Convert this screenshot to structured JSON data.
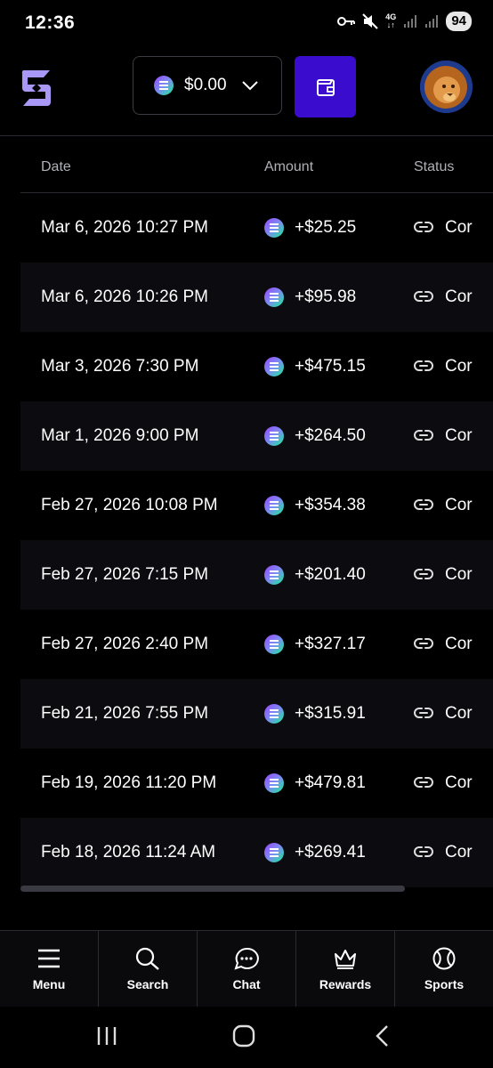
{
  "status_bar": {
    "time": "12:36",
    "network": [
      "4G",
      "↓↑"
    ],
    "battery": "94",
    "icons": [
      "vpn-key-icon",
      "mute-icon",
      "signal-icon",
      "signal-icon"
    ]
  },
  "header": {
    "logo": "app-logo-icon",
    "balance": "$0.00",
    "wallet_icon": "wallet-icon",
    "avatar": "lion-avatar",
    "accent_color": "#3a0ccd"
  },
  "table": {
    "columns": [
      "Date",
      "Amount",
      "Status"
    ],
    "rows": [
      {
        "date": "Mar 6, 2026 10:27 PM",
        "amount": "+$25.25",
        "status": "Cor"
      },
      {
        "date": "Mar 6, 2026 10:26 PM",
        "amount": "+$95.98",
        "status": "Cor"
      },
      {
        "date": "Mar 3, 2026 7:30 PM",
        "amount": "+$475.15",
        "status": "Cor"
      },
      {
        "date": "Mar 1, 2026 9:00 PM",
        "amount": "+$264.50",
        "status": "Cor"
      },
      {
        "date": "Feb 27, 2026 10:08 PM",
        "amount": "+$354.38",
        "status": "Cor"
      },
      {
        "date": "Feb 27, 2026 7:15 PM",
        "amount": "+$201.40",
        "status": "Cor"
      },
      {
        "date": "Feb 27, 2026 2:40 PM",
        "amount": "+$327.17",
        "status": "Cor"
      },
      {
        "date": "Feb 21, 2026 7:55 PM",
        "amount": "+$315.91",
        "status": "Cor"
      },
      {
        "date": "Feb 19, 2026 11:20 PM",
        "amount": "+$479.81",
        "status": "Cor"
      },
      {
        "date": "Feb 18, 2026 11:24 AM",
        "amount": "+$269.41",
        "status": "Cor"
      }
    ]
  },
  "bottom_nav": [
    {
      "label": "Menu",
      "icon": "menu-icon"
    },
    {
      "label": "Search",
      "icon": "search-icon"
    },
    {
      "label": "Chat",
      "icon": "chat-icon"
    },
    {
      "label": "Rewards",
      "icon": "crown-icon"
    },
    {
      "label": "Sports",
      "icon": "ball-icon"
    }
  ],
  "system_nav": [
    "recents-icon",
    "home-icon",
    "back-icon"
  ]
}
